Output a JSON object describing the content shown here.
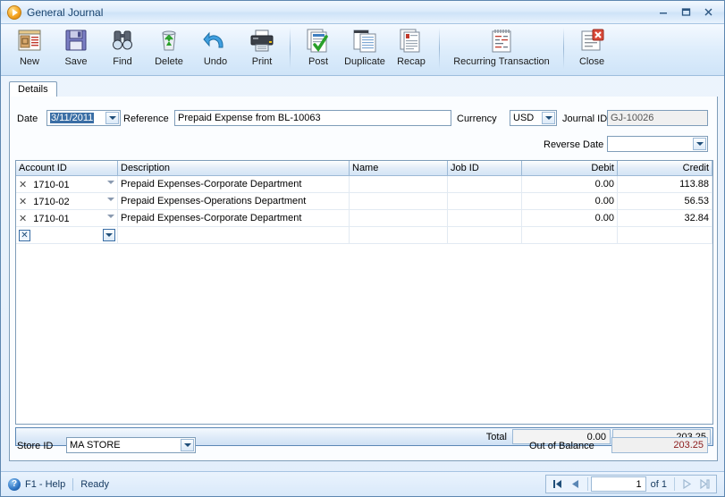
{
  "window": {
    "title": "General Journal",
    "icon": "orange-play-icon",
    "minimize_label": "–",
    "maximize_label": "❐",
    "close_label": "✕"
  },
  "toolbar": {
    "buttons": [
      {
        "label": "New",
        "icon": "new-document-icon"
      },
      {
        "label": "Save",
        "icon": "floppy-disk-icon"
      },
      {
        "label": "Find",
        "icon": "binoculars-icon"
      },
      {
        "label": "Delete",
        "icon": "recycle-bin-icon"
      },
      {
        "label": "Undo",
        "icon": "undo-arrow-icon"
      },
      {
        "label": "Print",
        "icon": "printer-icon"
      },
      {
        "label": "Post",
        "icon": "post-checkmark-icon"
      },
      {
        "label": "Duplicate",
        "icon": "duplicate-pages-icon"
      },
      {
        "label": "Recap",
        "icon": "recap-pages-icon"
      },
      {
        "label": "Recurring Transaction",
        "icon": "calendar-notepad-icon"
      },
      {
        "label": "Close",
        "icon": "close-document-icon"
      }
    ]
  },
  "tabs": [
    {
      "label": "Details",
      "active": true
    }
  ],
  "form": {
    "date_label": "Date",
    "date_value": "3/11/2011",
    "reference_label": "Reference",
    "reference_value": "Prepaid Expense from BL-10063",
    "currency_label": "Currency",
    "currency_value": "USD",
    "journal_id_label": "Journal ID",
    "journal_id_value": "GJ-10026",
    "reverse_date_label": "Reverse Date",
    "reverse_date_value": ""
  },
  "grid": {
    "columns": [
      "Account ID",
      "Description",
      "Name",
      "Job ID",
      "Debit",
      "Credit"
    ],
    "rows": [
      {
        "account_id": "1710-01",
        "description": "Prepaid Expenses-Corporate Department",
        "name": "",
        "job_id": "",
        "debit": "0.00",
        "credit": "113.88"
      },
      {
        "account_id": "1710-02",
        "description": "Prepaid Expenses-Operations Department",
        "name": "",
        "job_id": "",
        "debit": "0.00",
        "credit": "56.53"
      },
      {
        "account_id": "1710-01",
        "description": "Prepaid Expenses-Corporate Department",
        "name": "",
        "job_id": "",
        "debit": "0.00",
        "credit": "32.84"
      }
    ],
    "new_row": {
      "account_id": "",
      "description": "",
      "name": "",
      "job_id": "",
      "debit": "",
      "credit": ""
    }
  },
  "totals": {
    "label": "Total",
    "debit": "0.00",
    "credit": "203.25"
  },
  "footer": {
    "store_label": "Store ID",
    "store_value": "MA STORE",
    "out_of_balance_label": "Out of Balance",
    "out_of_balance_value": "203.25",
    "out_of_balance_color": "#8b1a1a"
  },
  "statusbar": {
    "help_icon": "question-mark-icon",
    "help_text": "F1 - Help",
    "status_text": "Ready",
    "nav": {
      "first_label": "first-record",
      "prev_label": "previous-record",
      "page_value": "1",
      "of_text": "of 1",
      "next_label": "next-record",
      "last_label": "last-record"
    }
  }
}
